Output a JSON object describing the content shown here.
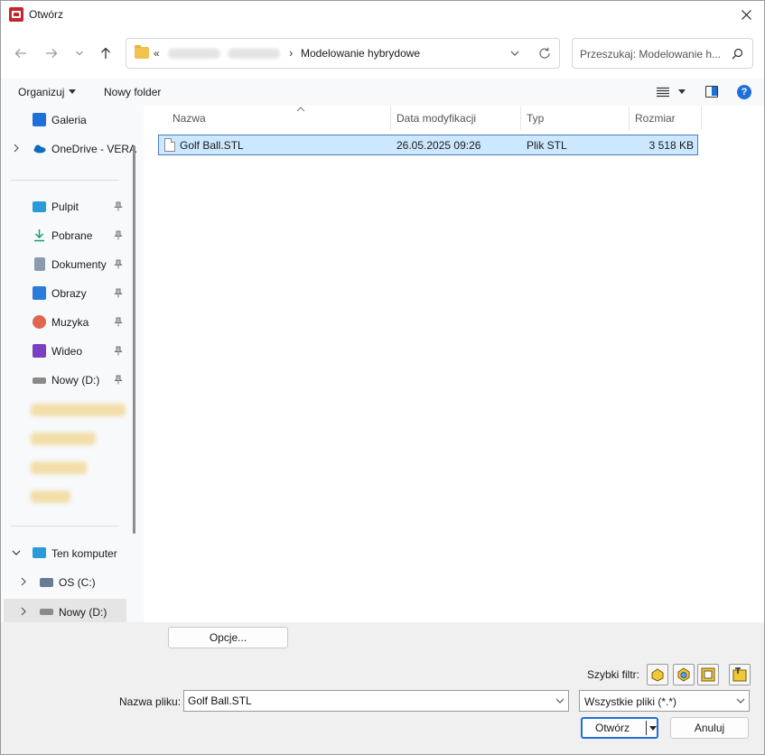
{
  "window": {
    "title": "Otwórz"
  },
  "navigation": {
    "breadcrumb_prefix": "«",
    "current_folder": "Modelowanie hybrydowe",
    "search_placeholder": "Przeszukaj: Modelowanie h..."
  },
  "toolbar": {
    "organize_label": "Organizuj",
    "new_folder_label": "Nowy folder",
    "help_label": "?"
  },
  "sidebar": {
    "items": [
      {
        "label": "Galeria",
        "icon": "gallery-icon",
        "pinned": false
      },
      {
        "label": "OneDrive - VERA",
        "icon": "onedrive-icon",
        "pinned": false
      },
      {
        "label": "Pulpit",
        "icon": "desktop-icon",
        "pinned": true
      },
      {
        "label": "Pobrane",
        "icon": "download-icon",
        "pinned": true
      },
      {
        "label": "Dokumenty",
        "icon": "documents-icon",
        "pinned": true
      },
      {
        "label": "Obrazy",
        "icon": "pictures-icon",
        "pinned": true
      },
      {
        "label": "Muzyka",
        "icon": "music-icon",
        "pinned": true
      },
      {
        "label": "Wideo",
        "icon": "video-icon",
        "pinned": true
      },
      {
        "label": "Nowy (D:)",
        "icon": "drive-icon",
        "pinned": true
      }
    ],
    "this_pc": "Ten komputer",
    "drives": [
      {
        "label": "OS (C:)",
        "icon": "os-drive-icon"
      },
      {
        "label": "Nowy (D:)",
        "icon": "drive-icon",
        "selected": true
      }
    ]
  },
  "file_list": {
    "columns": [
      "Nazwa",
      "Data modyfikacji",
      "Typ",
      "Rozmiar"
    ],
    "rows": [
      {
        "name": "Golf Ball.STL",
        "modified": "26.05.2025 09:26",
        "type": "Plik STL",
        "size": "3 518 KB",
        "selected": true
      }
    ]
  },
  "options_button": "Opcje...",
  "bottom": {
    "quick_filter_label": "Szybki filtr:",
    "file_name_label": "Nazwa pliku:",
    "file_name_value": "Golf Ball.STL",
    "file_type_value": "Wszystkie pliki (*.*)",
    "open_label": "Otwórz",
    "cancel_label": "Anuluj"
  },
  "colors": {
    "accent": "#1f6fd8",
    "selection_bg": "#cce8ff",
    "selection_border": "#4f7bc1",
    "folder": "#f2c14e"
  }
}
